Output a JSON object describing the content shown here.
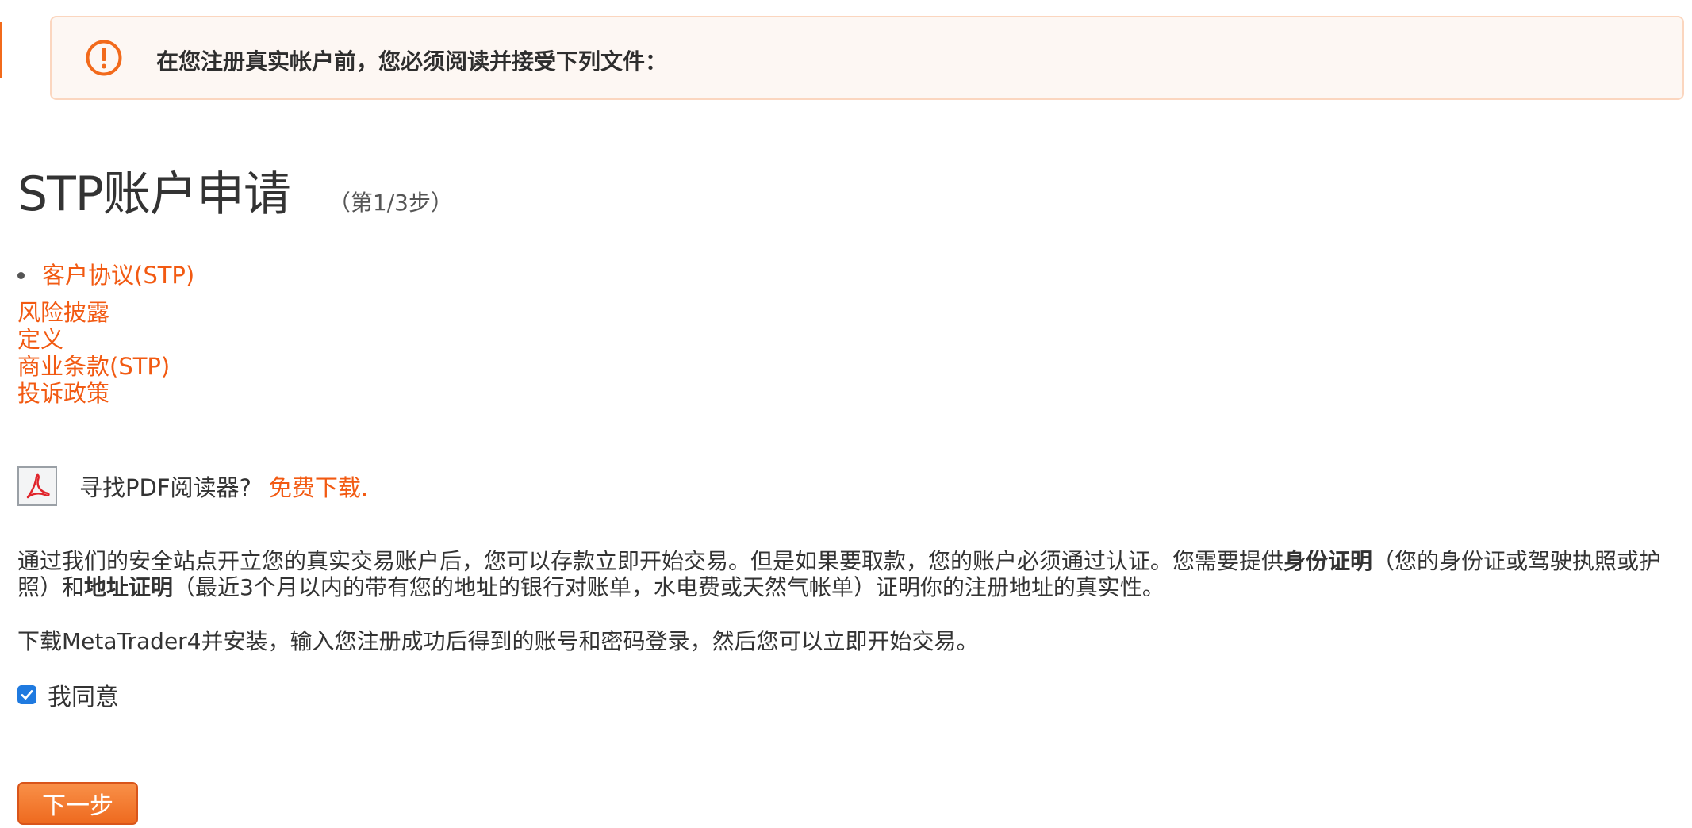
{
  "notice": {
    "icon": "exclamation-circle-icon",
    "text": "在您注册真实帐户前，您必须阅读并接受下列文件："
  },
  "header": {
    "title": "STP账户申请",
    "step": "（第1/3步）"
  },
  "documents": [
    {
      "label": "客户协议(STP)"
    },
    {
      "label": "风险披露"
    },
    {
      "label": "定义"
    },
    {
      "label": "商业条款(STP)"
    },
    {
      "label": "投诉政策"
    }
  ],
  "pdf": {
    "icon": "pdf-reader-icon",
    "text": "寻找PDF阅读器?",
    "link": "免费下载."
  },
  "info": {
    "part1": "通过我们的安全站点开立您的真实交易账户后，您可以存款立即开始交易。但是如果要取款，您的账户必须通过认证。您需要提供",
    "bold1": "身份证明",
    "part2": "（您的身份证或驾驶执照或护照）和",
    "bold2": "地址证明",
    "part3": "（最近3个月以内的带有您的地址的银行对账单，水电费或天然气帐单）证明你的注册地址的真实性。"
  },
  "mt4_text": "下载MetaTrader4并安装，输入您注册成功后得到的账号和密码登录，然后您可以立即开始交易。",
  "agree": {
    "label": "我同意",
    "checked": true
  },
  "next_button": {
    "label": "下一步"
  },
  "colors": {
    "accent": "#f25a12",
    "notice_border": "#fbd6bf",
    "notice_bg": "#fdf7f3",
    "checkbox": "#1f7ae0"
  }
}
